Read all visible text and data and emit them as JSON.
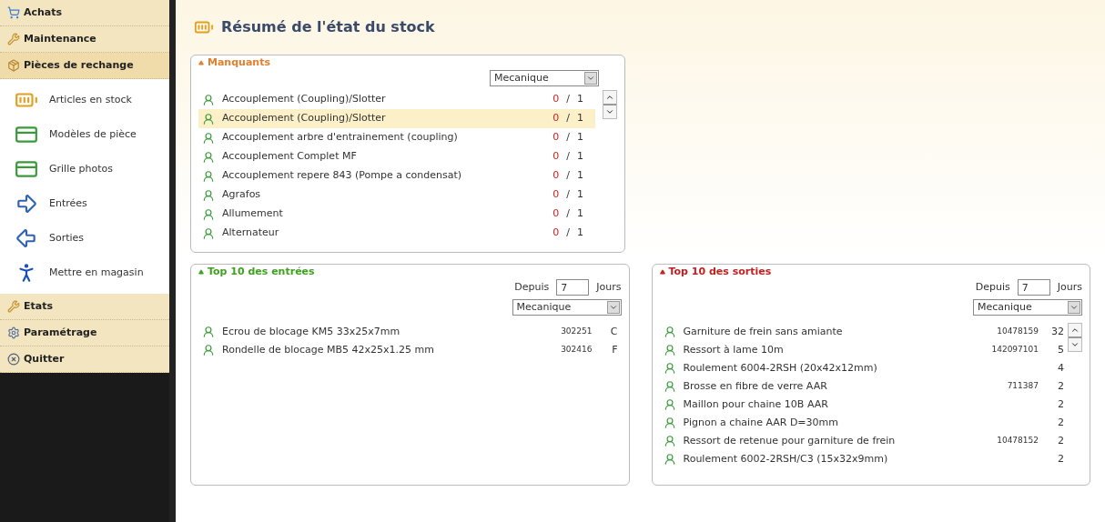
{
  "sidebar": {
    "items": [
      {
        "label": "Achats",
        "kind": "group",
        "selected": false
      },
      {
        "label": "Maintenance",
        "kind": "group",
        "selected": false
      },
      {
        "label": "Pièces de rechange",
        "kind": "group",
        "selected": true,
        "children": [
          {
            "label": "Articles en stock"
          },
          {
            "label": "Modèles de pièce"
          },
          {
            "label": "Grille photos"
          },
          {
            "label": "Entrées"
          },
          {
            "label": "Sorties"
          },
          {
            "label": "Mettre en magasin"
          }
        ]
      },
      {
        "label": "Etats",
        "kind": "group",
        "selected": false
      },
      {
        "label": "Paramétrage",
        "kind": "group",
        "selected": false
      },
      {
        "label": "Quitter",
        "kind": "group",
        "selected": false
      }
    ]
  },
  "page": {
    "title": "Résumé de l'état du stock"
  },
  "missing": {
    "title": "Manquants",
    "filter": "Mecanique",
    "separator": "/",
    "rows": [
      {
        "name": "Accouplement (Coupling)/Slotter",
        "stock": "0",
        "min": "1",
        "selected": false
      },
      {
        "name": "Accouplement (Coupling)/Slotter",
        "stock": "0",
        "min": "1",
        "selected": true
      },
      {
        "name": "Accouplement arbre d'entrainement (coupling)",
        "stock": "0",
        "min": "1",
        "selected": false
      },
      {
        "name": "Accouplement Complet MF",
        "stock": "0",
        "min": "1",
        "selected": false
      },
      {
        "name": "Accouplement repere 843 (Pompe a condensat)",
        "stock": "0",
        "min": "1",
        "selected": false
      },
      {
        "name": "Agrafos",
        "stock": "0",
        "min": "1",
        "selected": false
      },
      {
        "name": "Allumement",
        "stock": "0",
        "min": "1",
        "selected": false
      },
      {
        "name": "Alternateur",
        "stock": "0",
        "min": "1",
        "selected": false
      }
    ]
  },
  "entries": {
    "title": "Top 10 des entrées",
    "since_label": "Depuis",
    "days": "7",
    "days_label": "Jours",
    "filter": "Mecanique",
    "rows": [
      {
        "name": "Ecrou de blocage KM5 33x25x7mm",
        "ref": "302251",
        "qty": "C"
      },
      {
        "name": "Rondelle de blocage MB5 42x25x1.25 mm",
        "ref": "302416",
        "qty": "F"
      }
    ]
  },
  "exits": {
    "title": "Top 10 des sorties",
    "since_label": "Depuis",
    "days": "7",
    "days_label": "Jours",
    "filter": "Mecanique",
    "rows": [
      {
        "name": "Garniture de frein sans amiante",
        "ref": "10478159",
        "qty": "32"
      },
      {
        "name": "Ressort à lame 10m",
        "ref": "142097101",
        "qty": "5"
      },
      {
        "name": "Roulement 6004-2RSH (20x42x12mm)",
        "qty": "4"
      },
      {
        "name": "Brosse en fibre de verre AAR",
        "ref": "711387",
        "qty": "2"
      },
      {
        "name": "Maillon pour chaine 10B AAR",
        "qty": "2"
      },
      {
        "name": "Pignon a chaine AAR D=30mm",
        "qty": "2"
      },
      {
        "name": "Ressort de retenue pour garniture de frein",
        "ref": "10478152",
        "qty": "2"
      },
      {
        "name": "Roulement 6002-2RSH/C3 (15x32x9mm)",
        "qty": "2"
      }
    ]
  }
}
